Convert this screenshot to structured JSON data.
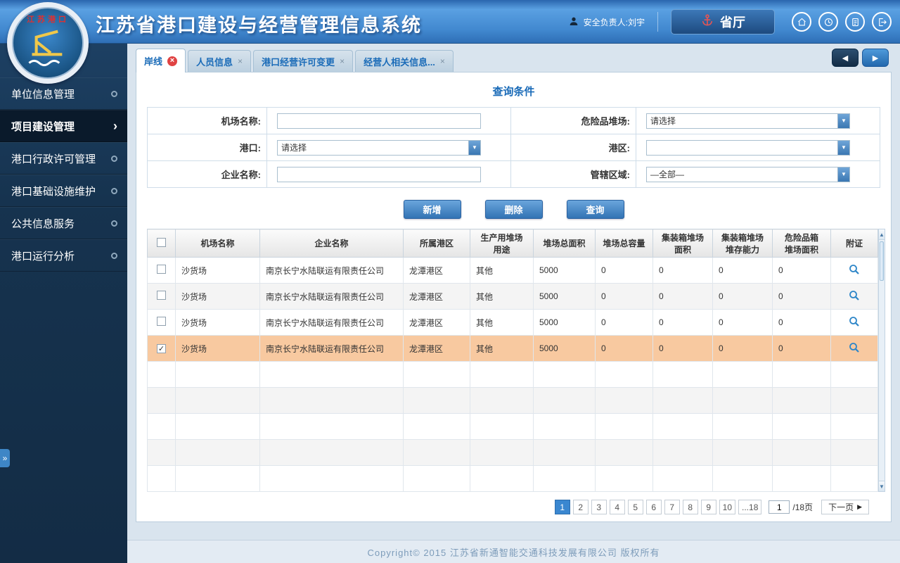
{
  "icons": {
    "back": "◀",
    "forward": "▶",
    "dropdown": "▼",
    "scroll_up": "▲",
    "scroll_down": "▼",
    "check": "✓",
    "close": "×",
    "chevron_right": "›",
    "collapse": "»",
    "next": "▶"
  },
  "logo": {
    "text": "江苏港口"
  },
  "header": {
    "title": "江苏省港口建设与经营管理信息系统",
    "user": "安全负责人:刘宇",
    "province_button": "省厅"
  },
  "sidebar": {
    "items": [
      {
        "label": "单位信息管理",
        "active": false
      },
      {
        "label": "项目建设管理",
        "active": true
      },
      {
        "label": "港口行政许可管理",
        "active": false
      },
      {
        "label": "港口基础设施维护",
        "active": false
      },
      {
        "label": "公共信息服务",
        "active": false
      },
      {
        "label": "港口运行分析",
        "active": false
      }
    ]
  },
  "tabs": [
    {
      "label": "岸线",
      "active": true
    },
    {
      "label": "人员信息",
      "active": false
    },
    {
      "label": "港口经营许可变更",
      "active": false
    },
    {
      "label": "经营人相关信息...",
      "active": false
    }
  ],
  "query": {
    "title": "查询条件",
    "rows": [
      [
        {
          "label": "机场名称:",
          "type": "input",
          "value": ""
        },
        {
          "label": "危险品堆场:",
          "type": "select",
          "value": "请选择"
        }
      ],
      [
        {
          "label": "港口:",
          "type": "select",
          "value": "请选择"
        },
        {
          "label": "港区:",
          "type": "select",
          "value": ""
        }
      ],
      [
        {
          "label": "企业名称:",
          "type": "input",
          "value": ""
        },
        {
          "label": "管辖区域:",
          "type": "select",
          "value": "—全部—"
        }
      ]
    ]
  },
  "toolbar": {
    "add_label": "新增",
    "delete_label": "删除",
    "search_label": "查询"
  },
  "table": {
    "headers": [
      "机场名称",
      "企业名称",
      "所属港区",
      "生产用堆场\n用途",
      "堆场总面积",
      "堆场总容量",
      "集装箱堆场\n面积",
      "集装箱堆场\n堆存能力",
      "危险品箱\n堆场面积",
      "附证"
    ],
    "rows": [
      {
        "checked": false,
        "selected": false,
        "check_glyph": "",
        "cells": [
          "沙货场",
          "南京长宁水陆联运有限责任公司",
          "龙潭港区",
          "其他",
          "5000",
          "0",
          "0",
          "0",
          "0"
        ]
      },
      {
        "checked": false,
        "selected": false,
        "check_glyph": "",
        "cells": [
          "沙货场",
          "南京长宁水陆联运有限责任公司",
          "龙潭港区",
          "其他",
          "5000",
          "0",
          "0",
          "0",
          "0"
        ]
      },
      {
        "checked": false,
        "selected": false,
        "check_glyph": "",
        "cells": [
          "沙货场",
          "南京长宁水陆联运有限责任公司",
          "龙潭港区",
          "其他",
          "5000",
          "0",
          "0",
          "0",
          "0"
        ]
      },
      {
        "checked": true,
        "selected": true,
        "check_glyph": "✓",
        "cells": [
          "沙货场",
          "南京长宁水陆联运有限责任公司",
          "龙潭港区",
          "其他",
          "5000",
          "0",
          "0",
          "0",
          "0"
        ]
      }
    ],
    "empty_row_count": 5
  },
  "pagination": {
    "pages": [
      "1",
      "2",
      "3",
      "4",
      "5",
      "6",
      "7",
      "8",
      "9",
      "10",
      "...18"
    ],
    "active_page": "1",
    "page_input_value": "1",
    "total_label": "/18页",
    "next_label": "下一页"
  },
  "footer": {
    "copyright": "Copyright© 2015 江苏省新通智能交通科技发展有限公司 版权所有"
  }
}
